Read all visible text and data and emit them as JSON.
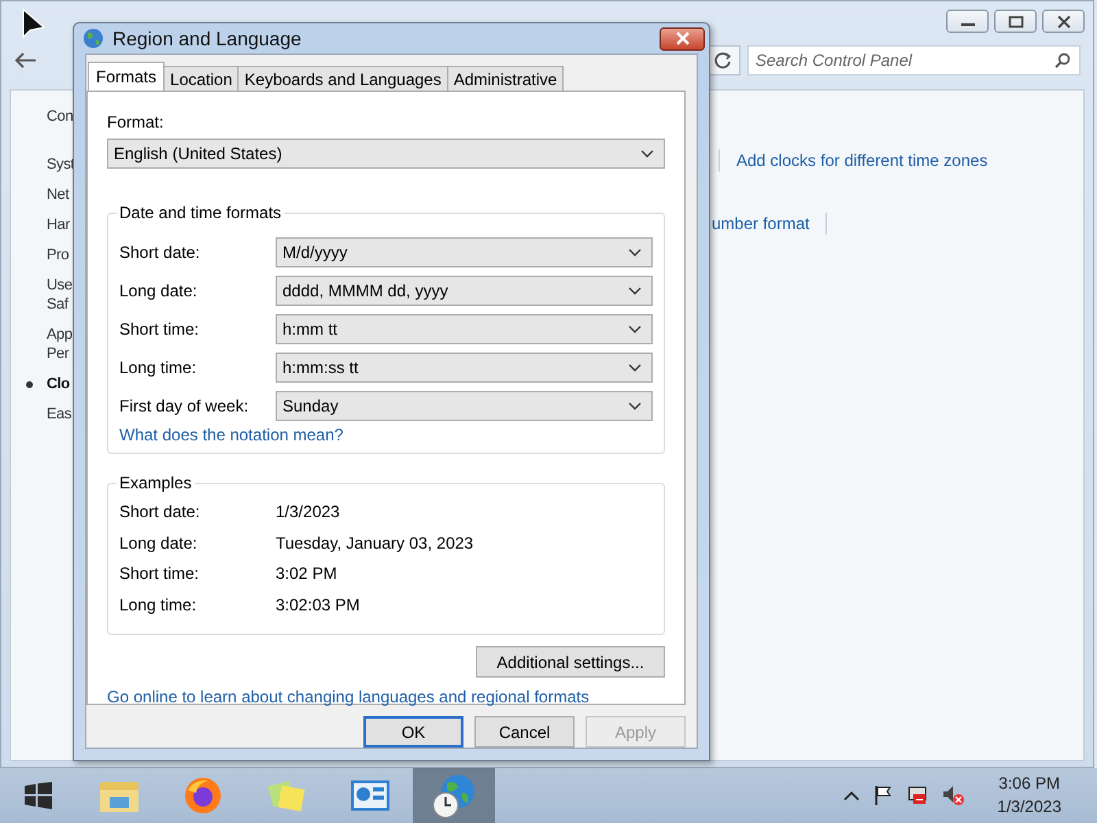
{
  "background_window": {
    "nav_items": [
      {
        "lines": [
          "Con"
        ],
        "selected": false
      },
      {
        "lines": [
          "Syst"
        ],
        "selected": false
      },
      {
        "lines": [
          "Net"
        ],
        "selected": false
      },
      {
        "lines": [
          "Har"
        ],
        "selected": false
      },
      {
        "lines": [
          "Pro"
        ],
        "selected": false
      },
      {
        "lines": [
          "Use",
          "Saf"
        ],
        "selected": false
      },
      {
        "lines": [
          "App",
          "Per"
        ],
        "selected": false
      },
      {
        "lines": [
          "Clo"
        ],
        "selected": true
      },
      {
        "lines": [
          "Eas"
        ],
        "selected": false
      }
    ],
    "search": {
      "placeholder": "Search Control Panel"
    },
    "links": [
      "Add clocks for different time zones",
      "umber format"
    ]
  },
  "dialog": {
    "title": "Region and Language",
    "tabs": [
      {
        "label": "Formats",
        "selected": true
      },
      {
        "label": "Location",
        "selected": false
      },
      {
        "label": "Keyboards and Languages",
        "selected": false
      },
      {
        "label": "Administrative",
        "selected": false
      }
    ],
    "format": {
      "label": "Format:",
      "value": "English (United States)"
    },
    "date_time_group": {
      "title": "Date and time formats",
      "fields": [
        {
          "label": "Short date:",
          "value": "M/d/yyyy"
        },
        {
          "label": "Long date:",
          "value": "dddd, MMMM dd, yyyy"
        },
        {
          "label": "Short time:",
          "value": "h:mm tt"
        },
        {
          "label": "Long time:",
          "value": "h:mm:ss tt"
        },
        {
          "label": "First day of week:",
          "value": "Sunday"
        }
      ],
      "link": "What does the notation mean?"
    },
    "examples": {
      "title": "Examples",
      "rows": [
        {
          "label": "Short date:",
          "value": "1/3/2023"
        },
        {
          "label": "Long date:",
          "value": "Tuesday, January 03, 2023"
        },
        {
          "label": "Short time:",
          "value": "3:02 PM"
        },
        {
          "label": "Long time:",
          "value": "3:02:03 PM"
        }
      ]
    },
    "additional_button": "Additional settings...",
    "online_link": "Go online to learn about changing languages and regional formats",
    "buttons": [
      {
        "label": "OK",
        "default": true,
        "disabled": false
      },
      {
        "label": "Cancel",
        "default": false,
        "disabled": false
      },
      {
        "label": "Apply",
        "default": false,
        "disabled": true
      }
    ]
  },
  "taskbar": {
    "apps": [
      {
        "kind": "start",
        "active": false
      },
      {
        "kind": "explorer",
        "active": false
      },
      {
        "kind": "firefox",
        "active": false
      },
      {
        "kind": "notes",
        "active": false
      },
      {
        "kind": "control-panel",
        "active": false
      },
      {
        "kind": "region",
        "active": true
      }
    ],
    "clock": {
      "time": "3:06 PM",
      "date": "1/3/2023"
    }
  }
}
